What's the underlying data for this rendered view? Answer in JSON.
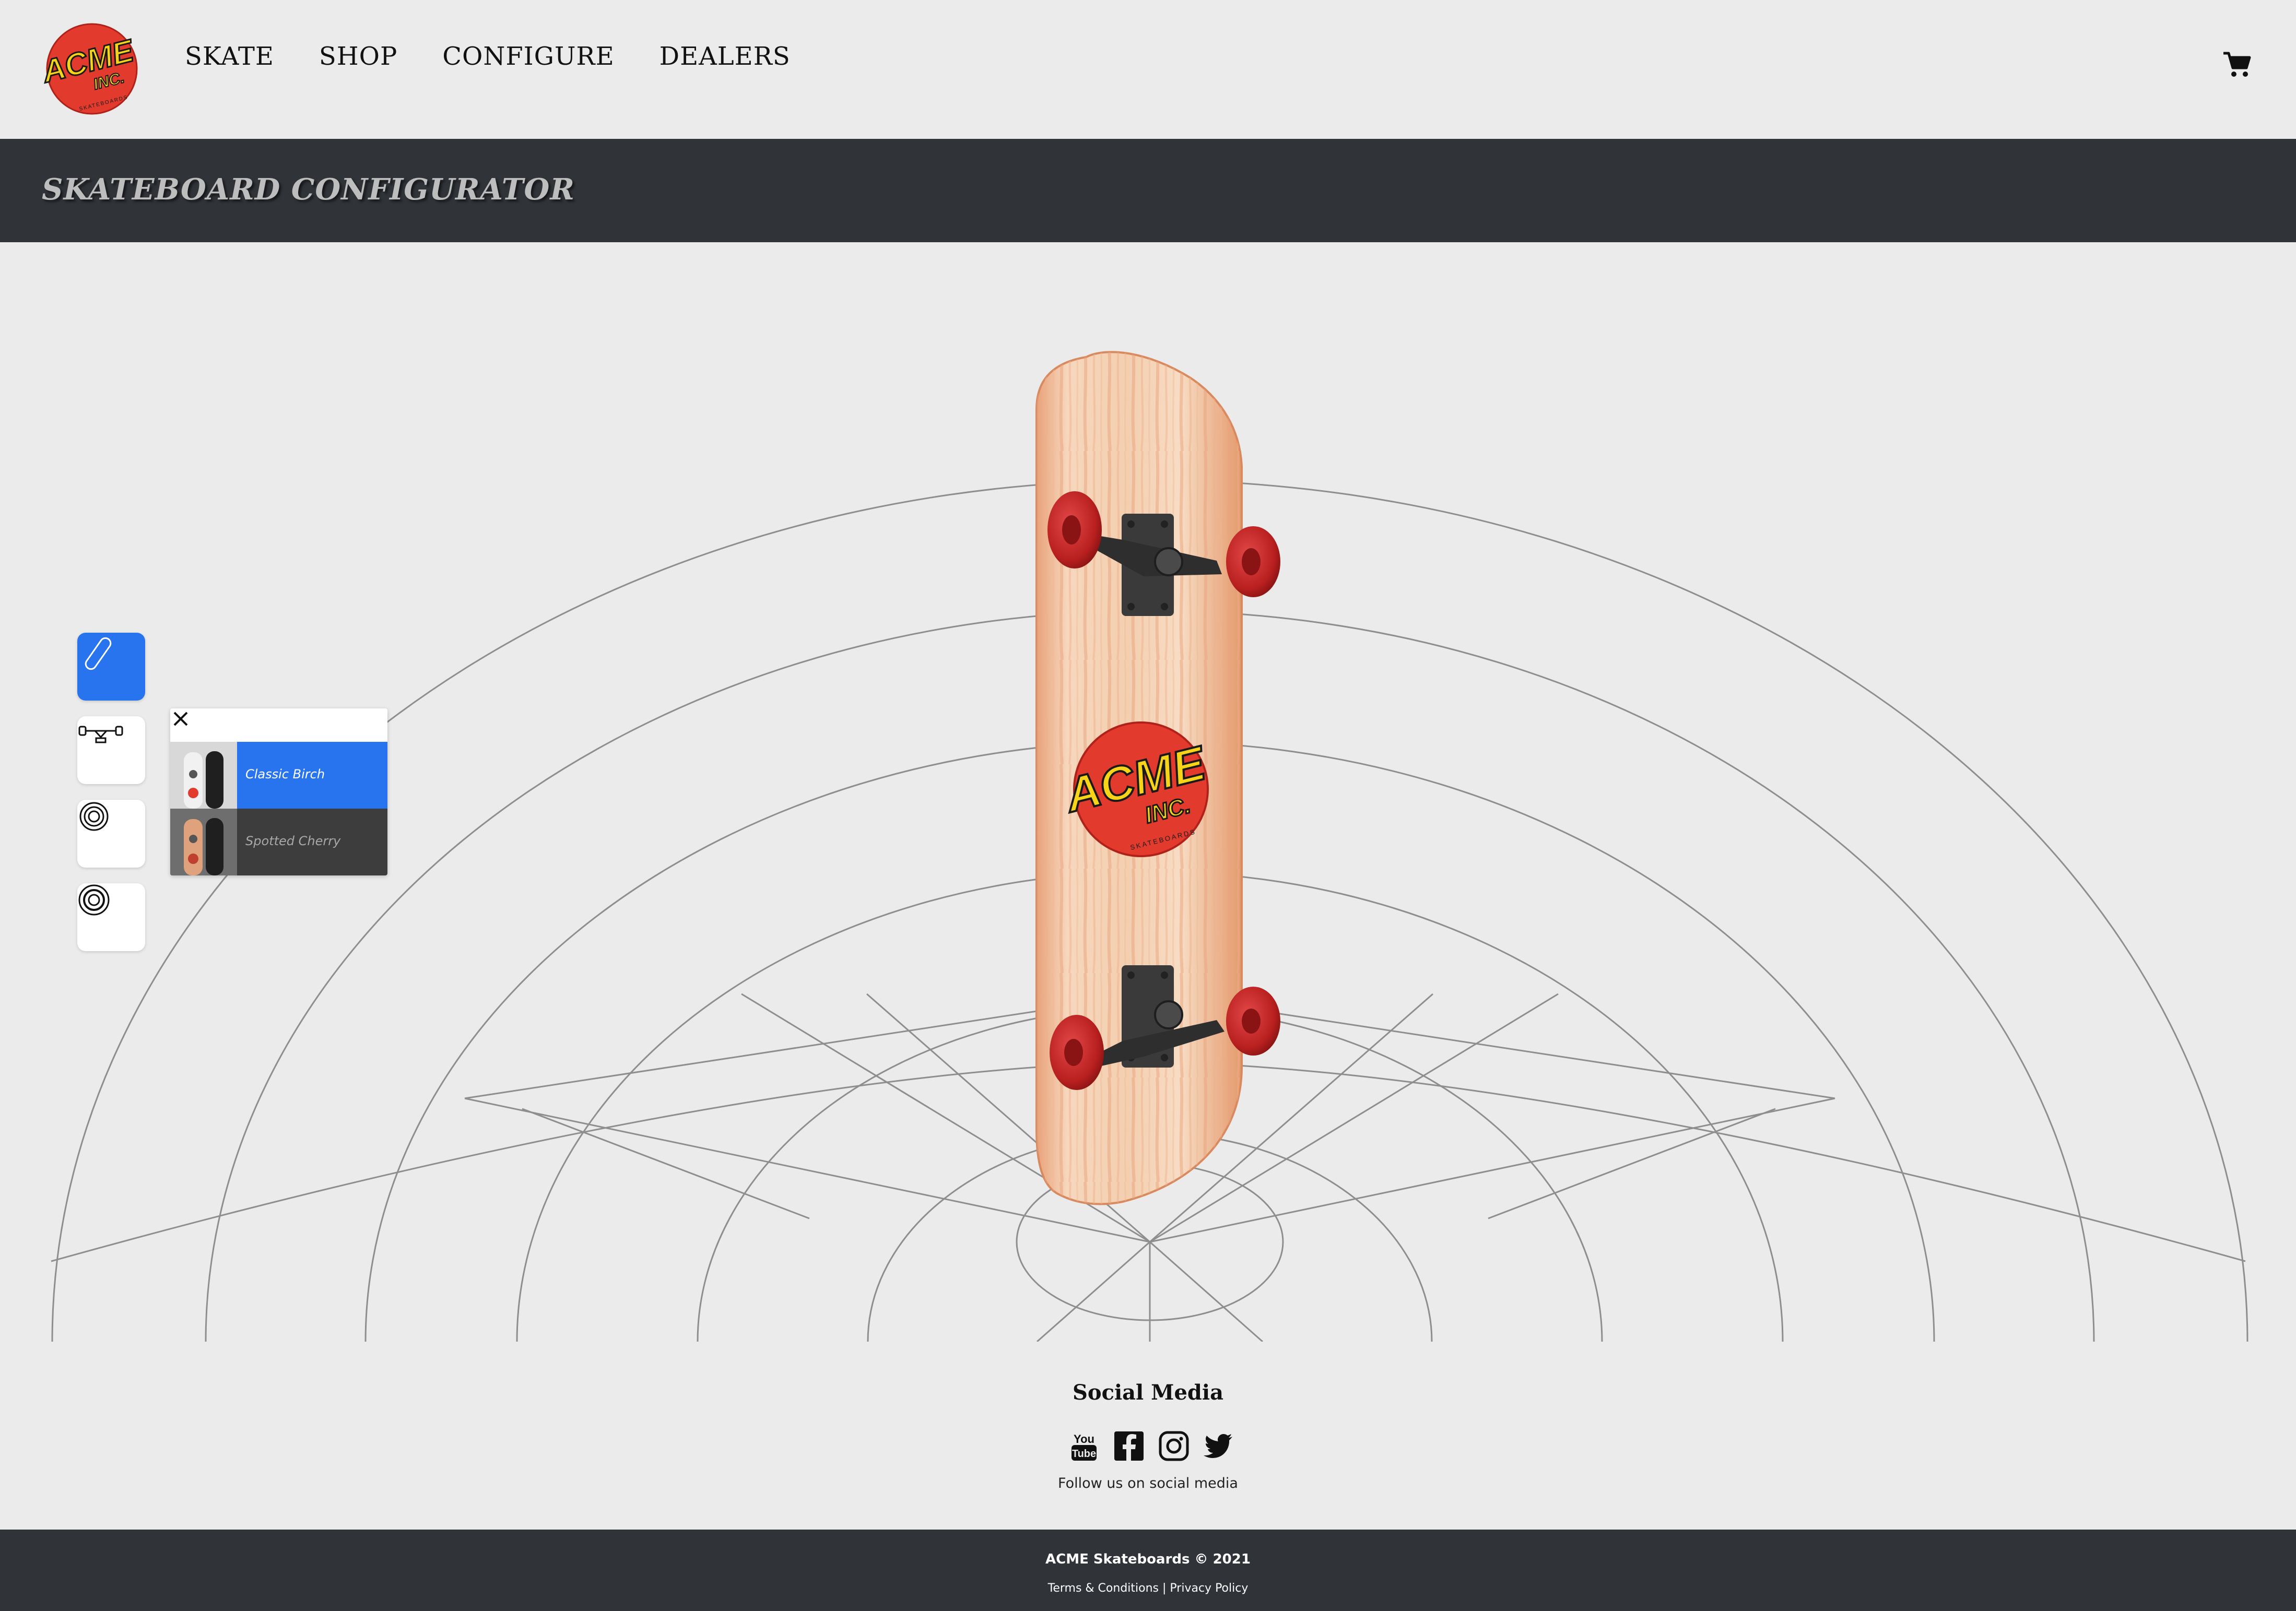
{
  "brand": {
    "logo_top": "ACME",
    "logo_bottom": "INC.",
    "logo_ring": "SKATEBOARDS",
    "color_red": "#e23b2e",
    "color_yellow": "#f7d417"
  },
  "nav": {
    "items": [
      "SKATE",
      "SHOP",
      "CONFIGURE",
      "DEALERS"
    ],
    "cart_icon": "shopping-cart-icon"
  },
  "header": {
    "title": "SKATEBOARD CONFIGURATOR"
  },
  "configurator": {
    "tools": [
      {
        "icon": "deck-icon",
        "active": true
      },
      {
        "icon": "truck-icon",
        "active": false
      },
      {
        "icon": "wheel-icon",
        "active": false
      },
      {
        "icon": "bearing-icon",
        "active": false
      }
    ],
    "deck_options": {
      "close_icon": "close-icon",
      "selected": "Classic Birch",
      "items": [
        "Classic Birch",
        "Spotted Cherry"
      ]
    },
    "colors": {
      "accent": "#2774ee",
      "deck_wood": "#f4d2b2",
      "wheel": "#b81f1f",
      "truck": "#3a3a3a"
    }
  },
  "social": {
    "title": "Social Media",
    "icons": [
      "youtube-icon",
      "facebook-icon",
      "instagram-icon",
      "twitter-icon"
    ],
    "youtube_top": "You",
    "youtube_bottom": "Tube",
    "subtitle": "Follow us on social media"
  },
  "footer": {
    "copyright": "ACME Skateboards © 2021",
    "links": [
      "Terms & Conditions",
      "Privacy Policy"
    ],
    "separator": "|"
  }
}
